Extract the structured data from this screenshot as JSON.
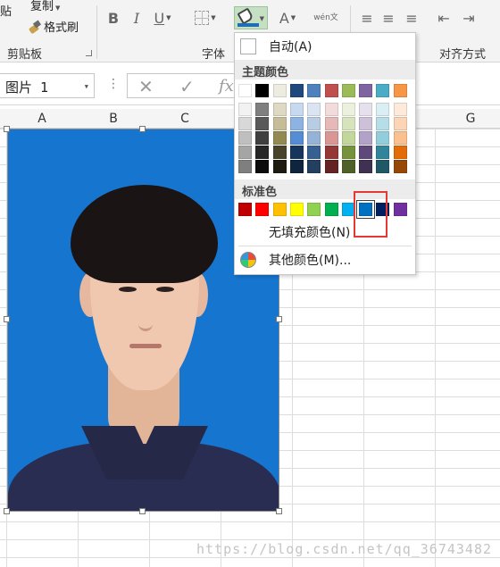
{
  "ribbon": {
    "clipboard": {
      "paste_label": "贴",
      "copy_label": "复制",
      "format_painter_label": "格式刷",
      "group_label": "剪贴板"
    },
    "font": {
      "bold_label": "B",
      "italic_label": "I",
      "underline_label": "U",
      "font_color_label": "A",
      "phonetic_label": "wén文",
      "group_label": "字体"
    },
    "alignment": {
      "group_label": "对齐方式"
    },
    "fill_color": "#1f6fb5"
  },
  "formula_bar": {
    "name_box_value": "图片 1",
    "fx_label": "fx"
  },
  "sheet": {
    "columns": [
      "A",
      "B",
      "C",
      "G"
    ]
  },
  "fill_menu": {
    "auto_label": "自动(A)",
    "theme_header": "主题颜色",
    "theme_top_row": [
      "#ffffff",
      "#000000",
      "#eeece1",
      "#1f497d",
      "#4f81bd",
      "#c0504d",
      "#9bbb59",
      "#8064a2",
      "#4bacc6",
      "#f79646"
    ],
    "theme_columns": [
      [
        "#f2f2f2",
        "#d8d8d8",
        "#bfbfbf",
        "#a5a5a5",
        "#7f7f7f"
      ],
      [
        "#7f7f7f",
        "#595959",
        "#3f3f3f",
        "#262626",
        "#0c0c0c"
      ],
      [
        "#ddd9c3",
        "#c4bd97",
        "#938953",
        "#494429",
        "#1d1b10"
      ],
      [
        "#c6d9f0",
        "#8db3e2",
        "#548dd4",
        "#17365d",
        "#0f243e"
      ],
      [
        "#dbe5f1",
        "#b8cce4",
        "#95b3d7",
        "#366092",
        "#244061"
      ],
      [
        "#f2dcdb",
        "#e5b9b7",
        "#d99694",
        "#953734",
        "#632423"
      ],
      [
        "#ebf1dd",
        "#d7e3bc",
        "#c3d69b",
        "#76923c",
        "#4f6128"
      ],
      [
        "#e5e0ec",
        "#ccc1d9",
        "#b2a2c7",
        "#5f497a",
        "#3f3151"
      ],
      [
        "#dbeef3",
        "#b7dde8",
        "#92cddc",
        "#31859b",
        "#205867"
      ],
      [
        "#fdeada",
        "#fbd5b5",
        "#fac08f",
        "#e36c09",
        "#974806"
      ]
    ],
    "standard_header": "标准色",
    "standard_colors": [
      "#c00000",
      "#ff0000",
      "#ffc000",
      "#ffff00",
      "#92d050",
      "#00b050",
      "#00b0f0",
      "#0070c0",
      "#002060",
      "#7030a0"
    ],
    "selected_standard_index": 7,
    "no_fill_label": "无填充颜色(N)",
    "more_colors_label": "其他颜色(M)..."
  },
  "watermark": "https://blog.csdn.net/qq_36743482"
}
